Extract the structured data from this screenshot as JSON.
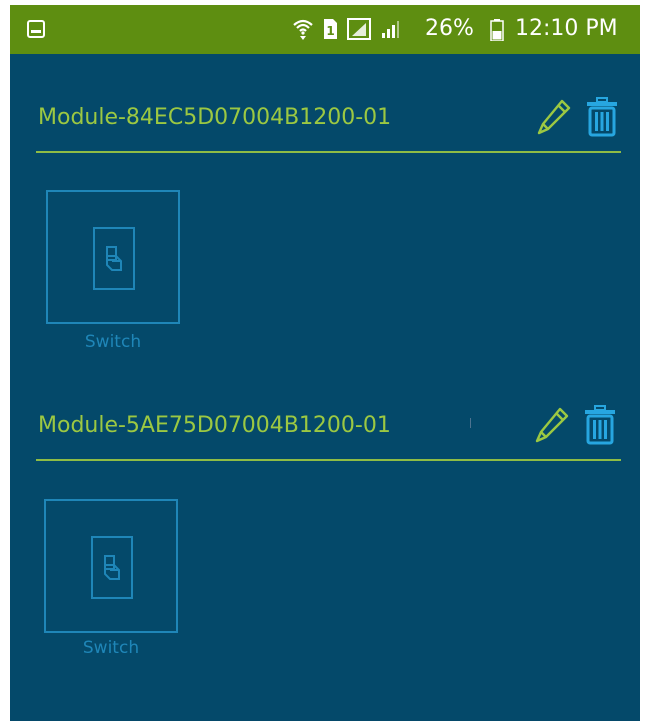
{
  "status_bar": {
    "battery_percent": "26%",
    "time": "12:10 PM",
    "icons": [
      "screen-capture-icon",
      "wifi-icon",
      "sim-icon",
      "signal-icon",
      "signal-icon",
      "battery-icon"
    ]
  },
  "modules": [
    {
      "name": "Module-84EC5D07004B1200-01",
      "devices": [
        {
          "label": "Switch",
          "icon": "light-switch-icon"
        }
      ]
    },
    {
      "name": "Module-5AE75D07004B1200-01",
      "devices": [
        {
          "label": "Switch",
          "icon": "light-switch-icon"
        }
      ]
    }
  ],
  "colors": {
    "background": "#04496a",
    "status_bar": "#5e8e11",
    "accent_green": "#9cc842",
    "accent_blue": "#1f86b8"
  }
}
